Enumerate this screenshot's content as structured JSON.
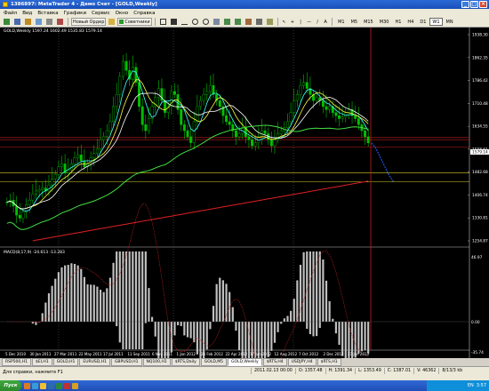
{
  "window": {
    "title": "1386897: MetaTrader 4 - Демо Счет - [GOLD,Weekly]"
  },
  "menu": [
    "Файл",
    "Вид",
    "Вставка",
    "Графики",
    "Сервис",
    "Окно",
    "Справка"
  ],
  "toolbar": {
    "new_order": "Новый Ордер",
    "advisors": "Советники",
    "timeframes": [
      "M1",
      "M5",
      "M15",
      "M30",
      "H1",
      "H4",
      "D1",
      "W1",
      "MN"
    ],
    "active_timeframe": "W1"
  },
  "chart": {
    "header": "GOLD,Weekly  1597.24 1602.49 1535.83 1579.14",
    "price_labels": [
      "1938.30",
      "1862.35",
      "1786.42",
      "1710.48",
      "1634.55",
      "1558.61",
      "1482.68",
      "1406.74",
      "1330.81",
      "1254.87"
    ],
    "current_price": "1579.14",
    "date_labels": [
      "5 Dec 2010",
      "30 Jan 2011",
      "27 Mar 2011",
      "22 May 2011",
      "17 Jul 2011",
      "11 Sep 2011",
      "6 Nov 2011",
      "1 Jan 2012",
      "26 Feb 2012",
      "22 Apr 2012",
      "17 Jun 2012",
      "12 Aug 2012",
      "7 Oct 2012",
      "2 Dec 2012",
      "27 Jan 2013"
    ],
    "macd_label": "MACD(8,17,9) -24.613 -13.283",
    "macd_labels": [
      "46.97",
      "0.00",
      "-35.74"
    ],
    "series": {
      "closes": [
        1383,
        1390,
        1370,
        1340,
        1330,
        1350,
        1375,
        1390,
        1410,
        1420,
        1425,
        1430,
        1420,
        1440,
        1460,
        1475,
        1500,
        1510,
        1480,
        1490,
        1510,
        1530,
        1540,
        1520,
        1500,
        1510,
        1530,
        1545,
        1560,
        1590,
        1600,
        1620,
        1650,
        1700,
        1740,
        1800,
        1850,
        1820,
        1790,
        1830,
        1780,
        1700,
        1640,
        1620,
        1660,
        1700,
        1730,
        1760,
        1720,
        1680,
        1700,
        1750,
        1740,
        1690,
        1640,
        1620,
        1600,
        1580,
        1650,
        1700,
        1720,
        1740,
        1750,
        1770,
        1740,
        1720,
        1700,
        1670,
        1650,
        1640,
        1620,
        1600,
        1610,
        1630,
        1600,
        1590,
        1570,
        1580,
        1600,
        1620,
        1610,
        1590,
        1570,
        1590,
        1610,
        1620,
        1630,
        1650,
        1680,
        1720,
        1740,
        1770,
        1780,
        1760,
        1740,
        1720,
        1730,
        1720,
        1700,
        1690,
        1700,
        1680,
        1670,
        1660,
        1665,
        1680,
        1690,
        1670,
        1660,
        1640,
        1620,
        1600,
        1579
      ],
      "projection": [
        1579,
        1560,
        1530,
        1500,
        1470,
        1450
      ]
    }
  },
  "tabs": [
    "RSP500,H1",
    "$EI,H1",
    "GOLD,H1",
    "EURUSD,H1",
    "GBPUSD,H1",
    "NQ100,H1",
    "$RTS,Daily",
    "GOLD,M5",
    "GOLD,Weekly",
    "$RTS,H4",
    "USDJPY,H4",
    "$RTS,H1"
  ],
  "active_tab": "GOLD,Weekly",
  "status": {
    "help": "Для справки, нажмите F1",
    "datetime": "2011.02.13 00:00",
    "open": "O: 1357.48",
    "high": "H: 1391.34",
    "low": "L: 1353.49",
    "close": "C: 1387.01",
    "volume": "V: 46362",
    "traffic": "8/13/3 kb"
  },
  "taskbar": {
    "start": "Пуск",
    "lang": "EN",
    "time": "3:57"
  }
}
